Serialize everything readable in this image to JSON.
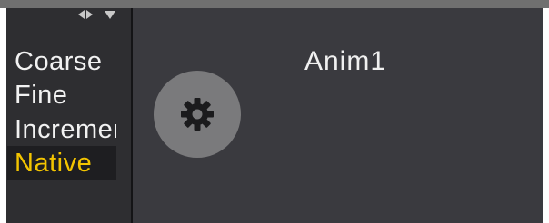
{
  "menu": {
    "items": [
      {
        "label": "Coarse"
      },
      {
        "label": "Fine"
      },
      {
        "label": "Increment"
      },
      {
        "label": "Native"
      }
    ],
    "selected_index": 3
  },
  "main": {
    "title": "Anim1",
    "settings_icon": "gear-icon"
  },
  "header": {
    "arrows_icon": "left-right-down-arrows-icon"
  },
  "colors": {
    "selected_text": "#f3c400",
    "panel_bg": "#3a3a3f",
    "left_panel_bg": "#2e2e31",
    "button_bg": "#7a7a7c"
  }
}
